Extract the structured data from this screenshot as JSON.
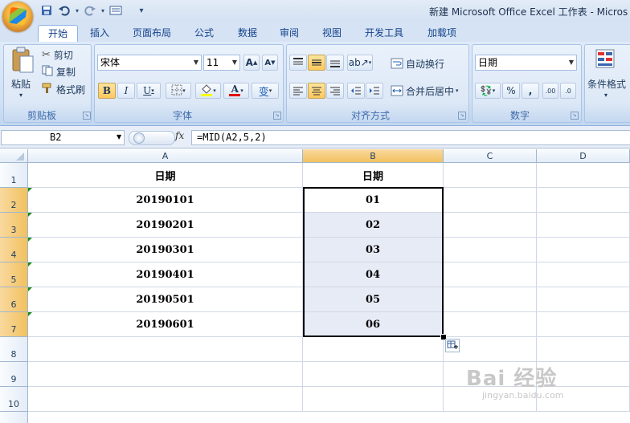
{
  "app": {
    "title": "新建 Microsoft Office Excel 工作表 - Micros",
    "quick_access": [
      "save-icon",
      "undo-icon",
      "redo-icon",
      "customize-icon"
    ]
  },
  "tabs": [
    "开始",
    "插入",
    "页面布局",
    "公式",
    "数据",
    "审阅",
    "视图",
    "开发工具",
    "加载项"
  ],
  "ribbon": {
    "clipboard": {
      "label": "剪贴板",
      "paste": "粘贴",
      "cut": "剪切",
      "copy": "复制",
      "format_painter": "格式刷"
    },
    "font": {
      "label": "字体",
      "name": "宋体",
      "size": "11",
      "bold": "B",
      "italic": "I",
      "underline": "U",
      "color_a": "A",
      "grow": "A",
      "shrink": "A",
      "wen": "变"
    },
    "alignment": {
      "label": "对齐方式",
      "wrap": "自动换行",
      "merge": "合并后居中"
    },
    "number": {
      "label": "数字",
      "format": "日期",
      "percent": "%",
      "comma": ","
    },
    "styles": {
      "conditional": "条件格式"
    }
  },
  "formula_bar": {
    "name_box": "B2",
    "fx": "fx",
    "formula": "=MID(A2,5,2)"
  },
  "sheet": {
    "columns": [
      "A",
      "B",
      "C",
      "D"
    ],
    "rows": [
      "1",
      "2",
      "3",
      "4",
      "5",
      "6",
      "7",
      "8",
      "9",
      "10"
    ],
    "header_row": {
      "A": "日期",
      "B": "日期"
    },
    "data": [
      {
        "A": "20190101",
        "B": "01"
      },
      {
        "A": "20190201",
        "B": "02"
      },
      {
        "A": "20190301",
        "B": "03"
      },
      {
        "A": "20190401",
        "B": "04"
      },
      {
        "A": "20190501",
        "B": "05"
      },
      {
        "A": "20190601",
        "B": "06"
      }
    ],
    "selected_range": "B2:B7",
    "selection_color": "#e7ebf5"
  },
  "watermark": {
    "text": "Bai 经验",
    "sub": "jingyan.baidu.com"
  }
}
